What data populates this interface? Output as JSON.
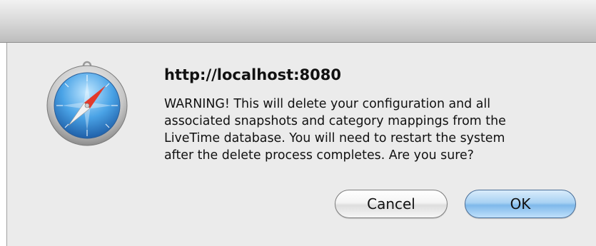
{
  "dialog": {
    "icon": "safari-compass-icon",
    "title": "http://localhost:8080",
    "message_lines": [
      "WARNING! This will delete your configuration and all",
      "associated snapshots and category mappings from the",
      "LiveTime database. You will need to restart the system",
      "after the delete process completes. Are you sure?"
    ],
    "buttons": {
      "cancel_label": "Cancel",
      "ok_label": "OK"
    }
  },
  "colors": {
    "dialog_background": "#ebebeb",
    "default_button": "#7fb9ea"
  }
}
